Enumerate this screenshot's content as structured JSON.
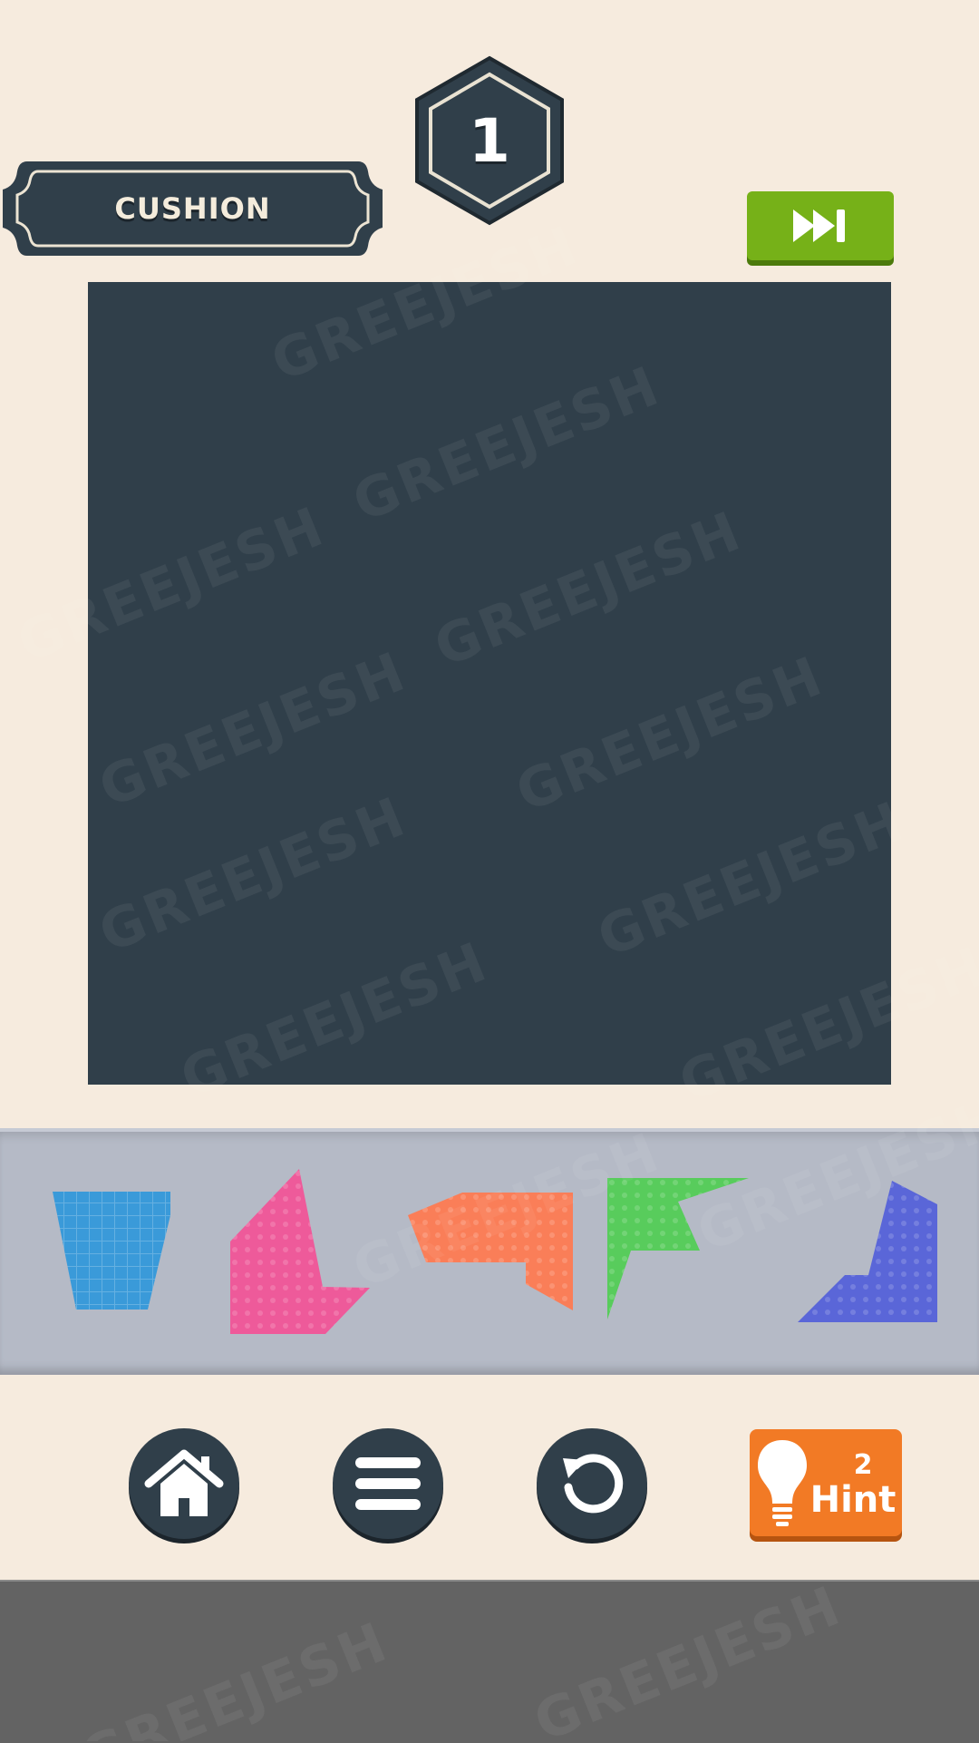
{
  "level": {
    "number": "1",
    "name": "CUSHION"
  },
  "buttons": {
    "skip": {
      "icon": "fast-forward-icon",
      "color": "#76b118"
    },
    "home": {
      "icon": "home-icon"
    },
    "menu": {
      "icon": "menu-icon"
    },
    "restart": {
      "icon": "restart-icon"
    },
    "hint": {
      "icon": "lightbulb-icon",
      "count": "2",
      "label": "Hint",
      "color": "#f27a25"
    }
  },
  "board": {
    "color": "#303f4a"
  },
  "pieces": [
    {
      "name": "blue-trapezoid-piece",
      "color": "#3a9ad9",
      "pattern": "grid"
    },
    {
      "name": "pink-pentagon-piece",
      "color": "#ee5a9a",
      "pattern": "dots"
    },
    {
      "name": "orange-hook-piece",
      "color": "#fa7e58",
      "pattern": "hearts"
    },
    {
      "name": "green-arrow-piece",
      "color": "#58cc5c",
      "pattern": "circles"
    },
    {
      "name": "purple-wedge-piece",
      "color": "#5a66d8",
      "pattern": "stars"
    }
  ],
  "watermark": "GREEJESH"
}
